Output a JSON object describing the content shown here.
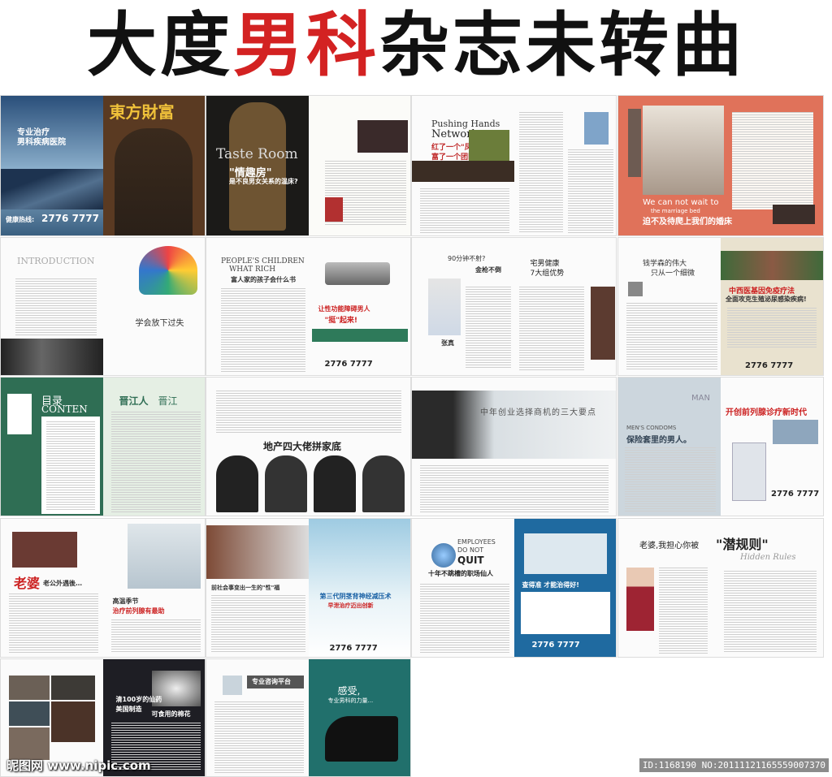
{
  "title": {
    "part1": "大度",
    "part2": "男科",
    "part3": "杂志未转曲"
  },
  "colors": {
    "red": "#d32222",
    "dark": "#111111"
  },
  "pages": {
    "p1": {
      "line1": "专业治疗",
      "line2": "男科疾病医院",
      "hotline_label": "健康热线:",
      "hotline": "2776 7777"
    },
    "p2": {
      "headline": "東方財富"
    },
    "p3": {
      "headline": "Taste Room",
      "sub1": "\"情趣房\"",
      "sub2": "是不良男女关系的温床?"
    },
    "p5": {
      "en1": "Pushing Hands",
      "en2": "Network",
      "cn1": "红了一个\"凤姐\"",
      "cn2": "富了一个团队"
    },
    "p7": {
      "en": "We can not wait to",
      "en2": "the marriage bed",
      "cn": "迫不及待爬上我们的婚床"
    },
    "p8": {
      "en": "INTRODUCTION",
      "cn": "学会放下过失"
    },
    "p9": {
      "en1": "PEOPLE'S CHILDREN",
      "en2": "WHAT RICH",
      "cn": "富人家的孩子会什么书",
      "ad1": "让性功能障碍男人",
      "ad2": "\"挺\"起来!",
      "phone": "2776 7777"
    },
    "p11": {
      "h1": "90分钟不射?",
      "h2": "金枪不倒",
      "h3": "宅男健康",
      "h4": "7大组优势",
      "name": "张真"
    },
    "p13": {
      "h1": "钱学森的伟大",
      "h2": "只从一个细微",
      "ad1": "中西医基因免疫疗法",
      "ad2": "全面攻克生殖泌尿感染疾病!",
      "phone": "2776 7777"
    },
    "p14": {
      "cn": "目录",
      "en": "CONTEN"
    },
    "p15": {
      "h": "晋江人",
      "h2": "晋江"
    },
    "p16": {
      "h": "地产四大佬拼家底"
    },
    "p17": {
      "h": "中年创业选择商机的三大要点"
    },
    "p18": {
      "en": "MAN",
      "en2": "MEN'S CONDOMS",
      "cn": "保险套里的男人。",
      "ad": "开创前列腺诊疗新时代",
      "phone": "2776 7777"
    },
    "p19": {
      "h1": "老婆",
      "h2": "老公外遇後…",
      "h3": "高温季节",
      "h4": "治疗前列腺有最助"
    },
    "p20": {
      "h": "前社会事变出一生的\"性\"福",
      "ad": "第三代阴茎背神经减压术",
      "ad2": "早泄治疗迈出创新",
      "phone": "2776 7777"
    },
    "p21": {
      "en1": "EMPLOYEES",
      "en2": "DO NOT",
      "en3": "QUIT",
      "cn": "十年不跳槽的职场仙人",
      "ad": "查得准 才能治得好!",
      "phone": "2776 7777"
    },
    "p22": {
      "h": "老婆,我担心你被",
      "h2": "\"潜规则\"",
      "en": "Hidden Rules"
    },
    "p23": {
      "h1": "清100岁的仙药",
      "h2": "美国制造",
      "h3": "可食用的棉花"
    },
    "p24": {
      "h": "专业咨询平台"
    },
    "p25": {
      "h": "感受,",
      "sub": "专业男科的力量..."
    }
  },
  "watermark": "昵图网 www.nipic.com",
  "image_id": "ID:1168190 NO:20111121165559007370"
}
